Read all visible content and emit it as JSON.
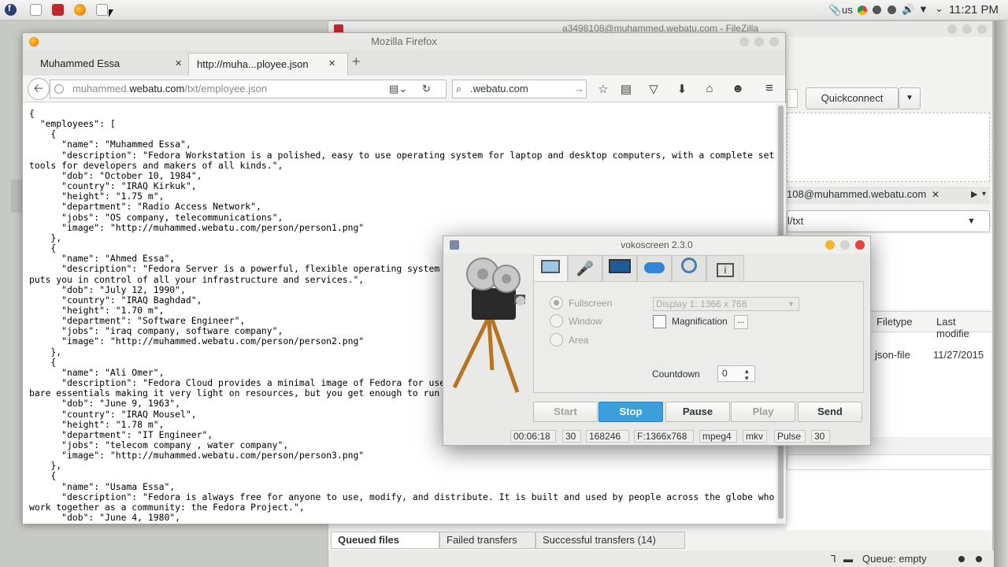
{
  "taskbar": {
    "icons": [
      "fedora-icon",
      "window-icon",
      "filezilla-icon",
      "firefox-icon",
      "screenshot-icon"
    ],
    "keyboard_layout": "us",
    "time": "11:21 PM"
  },
  "filezilla": {
    "title": "a3498108@muhammed.webatu.com - FileZilla",
    "quickconnect": "Quickconnect",
    "remote_tab": "108@muhammed.webatu.com",
    "remote_path": "l/txt",
    "col_filetype": "Filetype",
    "col_lastmod": "Last modifie",
    "file_type": "json-file",
    "file_date": "11/27/2015",
    "queue_tabs": [
      "Queued files",
      "Failed transfers",
      "Successful transfers (14)"
    ],
    "queue_status": "Queue: empty"
  },
  "firefox": {
    "title": "Mozilla Firefox",
    "tabs": [
      "Muhammed Essa",
      "http://muha...ployee.json"
    ],
    "url_pre": "muhammed.",
    "url_host": "webatu.com",
    "url_post": "/txt/employee.json",
    "search": ".webatu.com",
    "content": "{\n  \"employees\": [\n    {\n      \"name\": \"Muhammed Essa\",\n      \"description\": \"Fedora Workstation is a polished, easy to use operating system for laptop and desktop computers, with a complete set of\ntools for developers and makers of all kinds.\",\n      \"dob\": \"October 10, 1984\",\n      \"country\": \"IRAQ Kirkuk\",\n      \"height\": \"1.75 m\",\n      \"department\": \"Radio Access Network\",\n      \"jobs\": \"OS company, telecommunications\",\n      \"image\": \"http://muhammed.webatu.com/person/person1.png\"\n    },\n    {\n      \"name\": \"Ahmed Essa\",\n      \"description\": \"Fedora Server is a powerful, flexible operating system tha\nputs you in control of all your infrastructure and services.\",\n      \"dob\": \"July 12, 1990\",\n      \"country\": \"IRAQ Baghdad\",\n      \"height\": \"1.70 m\",\n      \"department\": \"Software Engineer\",\n      \"jobs\": \"iraq company, software company\",\n      \"image\": \"http://muhammed.webatu.com/person/person2.png\"\n    },\n    {\n      \"name\": \"Ali Omer\",\n      \"description\": \"Fedora Cloud provides a minimal image of Fedora for use in\nbare essentials making it very light on resources, but you get enough to run you\n      \"dob\": \"June 9, 1963\",\n      \"country\": \"IRAQ Mousel\",\n      \"height\": \"1.78 m\",\n      \"department\": \"IT Engineer\",\n      \"jobs\": \"telecom company , water company\",\n      \"image\": \"http://muhammed.webatu.com/person/person3.png\"\n    },\n    {\n      \"name\": \"Usama Essa\",\n      \"description\": \"Fedora is always free for anyone to use, modify, and distribute. It is built and used by people across the globe who\nwork together as a community: the Fedora Project.\",\n      \"dob\": \"June 4, 1980\","
  },
  "vokoscreen": {
    "title": "vokoscreen 2.3.0",
    "modes": [
      "Fullscreen",
      "Window",
      "Area"
    ],
    "display": "Display 1:  1366 x 768",
    "magnification": "Magnification",
    "mag_btn": "...",
    "countdown_label": "Countdown",
    "countdown_value": "0",
    "buttons": [
      "Start",
      "Stop",
      "Pause",
      "Play",
      "Send"
    ],
    "status": [
      "00:06:18",
      "30",
      "168246",
      "F:1366x768",
      "mpeg4",
      "mkv",
      "Pulse",
      "30"
    ],
    "accent": "#3a9fdb"
  }
}
